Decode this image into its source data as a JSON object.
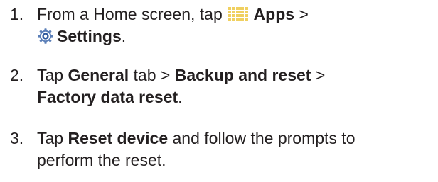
{
  "steps": [
    {
      "number": "1.",
      "parts": {
        "a": "From a Home screen, tap ",
        "apps_icon": "apps-grid-icon",
        "b": "Apps",
        "c": " >",
        "settings_icon": "gear-icon",
        "d": "Settings",
        "e": "."
      }
    },
    {
      "number": "2.",
      "parts": {
        "a": "Tap ",
        "b": "General",
        "c": " tab > ",
        "d": "Backup and reset",
        "e": " >",
        "f": "Factory data reset",
        "g": "."
      }
    },
    {
      "number": "3.",
      "parts": {
        "a": "Tap ",
        "b": "Reset device",
        "c": " and follow the prompts to",
        "d": "perform the reset."
      }
    }
  ],
  "colors": {
    "text": "#231f20",
    "apps_icon": "#f0d060",
    "settings_icon_outer": "#5b7fb8",
    "settings_icon_inner": "#2f5a9e"
  }
}
